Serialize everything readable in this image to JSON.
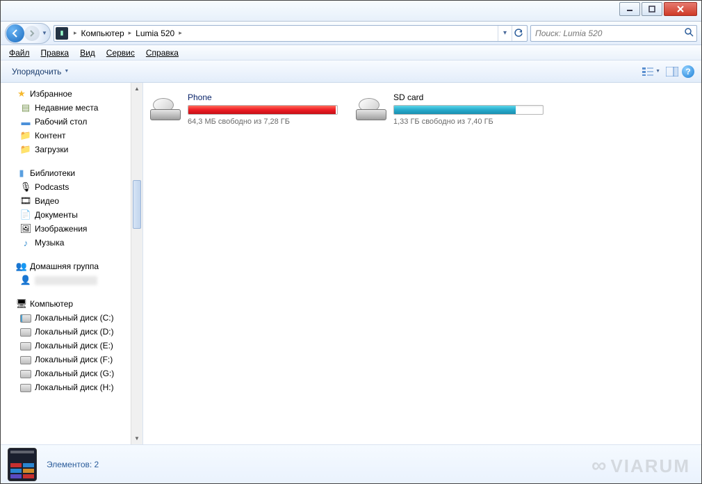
{
  "breadcrumb": {
    "root": "Компьютер",
    "folder": "Lumia 520"
  },
  "search": {
    "placeholder": "Поиск: Lumia 520"
  },
  "menu": {
    "file": "Файл",
    "edit": "Правка",
    "view": "Вид",
    "tools": "Сервис",
    "help": "Справка"
  },
  "toolbar": {
    "organize": "Упорядочить"
  },
  "nav": {
    "favorites": {
      "label": "Избранное",
      "items": [
        "Недавние места",
        "Рабочий стол",
        "Контент",
        "Загрузки"
      ]
    },
    "libraries": {
      "label": "Библиотеки",
      "items": [
        "Podcasts",
        "Видео",
        "Документы",
        "Изображения",
        "Музыка"
      ]
    },
    "homegroup": {
      "label": "Домашняя группа",
      "user": " "
    },
    "computer": {
      "label": "Компьютер",
      "drives": [
        "Локальный диск (C:)",
        "Локальный диск (D:)",
        "Локальный диск (E:)",
        "Локальный диск (F:)",
        "Локальный диск (G:)",
        "Локальный диск (H:)"
      ]
    }
  },
  "content": {
    "drives": [
      {
        "name": "Phone",
        "status": "64,3 МБ свободно из 7,28 ГБ",
        "fill": 99,
        "color": "red"
      },
      {
        "name": "SD card",
        "status": "1,33 ГБ свободно из 7,40 ГБ",
        "fill": 82,
        "color": "blue"
      }
    ]
  },
  "details": {
    "summary": "Элементов: 2"
  },
  "watermark": "VIARUM"
}
